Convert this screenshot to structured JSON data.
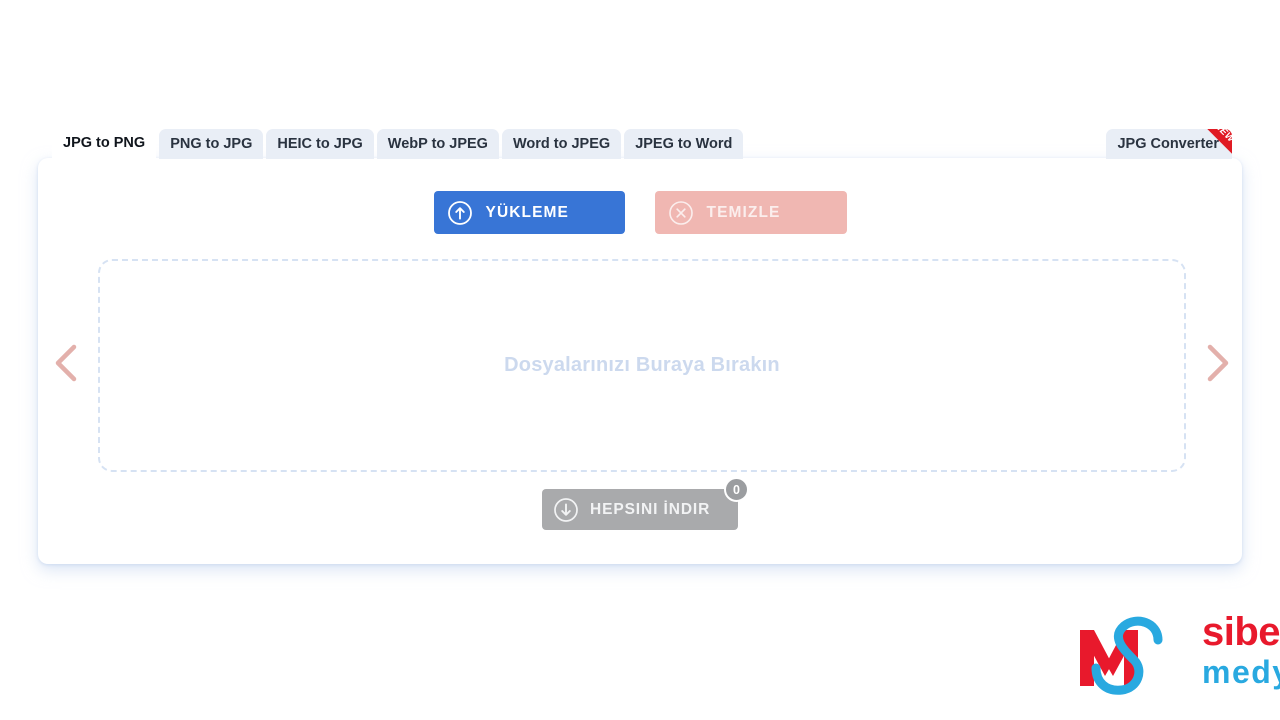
{
  "tabs": {
    "items": [
      {
        "label": "JPG to PNG",
        "active": true
      },
      {
        "label": "PNG to JPG",
        "active": false
      },
      {
        "label": "HEIC to JPG",
        "active": false
      },
      {
        "label": "WebP to JPEG",
        "active": false
      },
      {
        "label": "Word to JPEG",
        "active": false
      },
      {
        "label": "JPEG to Word",
        "active": false
      }
    ],
    "right_tab": {
      "label": "JPG Converter",
      "ribbon": "NEW"
    }
  },
  "toolbar": {
    "upload_label": "YÜKLEME",
    "upload_icon": "arrow-up-circle-icon",
    "clear_label": "TEMIZLE",
    "clear_icon": "x-circle-icon"
  },
  "dropzone": {
    "text": "Dosyalarınızı Buraya Bırakın"
  },
  "download": {
    "label": "HEPSINI İNDIR",
    "icon": "arrow-down-circle-icon",
    "count": "0"
  },
  "nav": {
    "prev_icon": "chevron-left-icon",
    "next_icon": "chevron-right-icon"
  },
  "logo": {
    "primary": "siber",
    "secondary": "medya",
    "mark": "sm-monogram-icon"
  },
  "colors": {
    "accent_blue": "#3875d6",
    "clear_pink": "#f0b7b2",
    "download_gray": "#a9aaac",
    "ribbon_red": "#e01b24",
    "logo_red": "#e8192c",
    "logo_blue": "#29a9e0",
    "dropzone_border": "#d6e2f3",
    "tab_inactive": "#e9eef6"
  }
}
